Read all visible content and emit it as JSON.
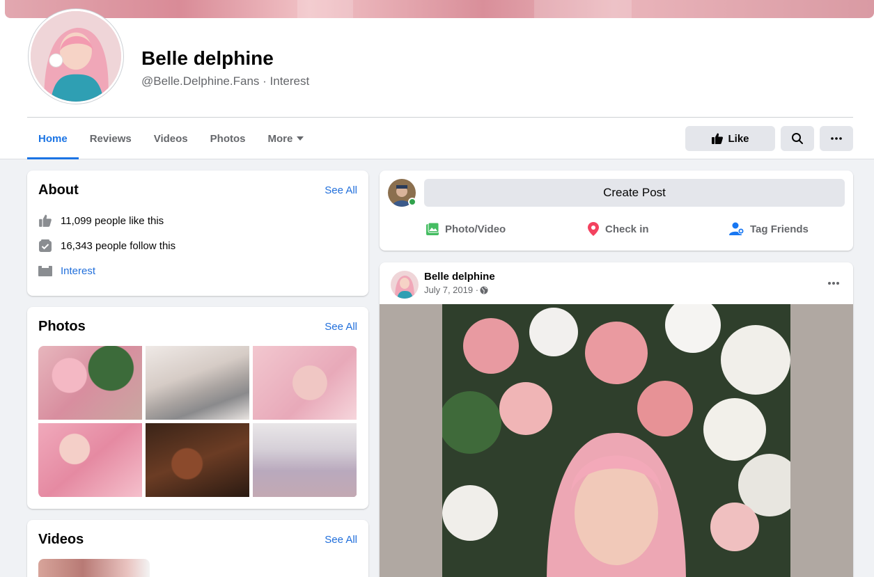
{
  "page": {
    "name": "Belle delphine",
    "handle_line": "@Belle.Delphine.Fans · Interest"
  },
  "tabs": [
    {
      "label": "Home",
      "active": true
    },
    {
      "label": "Reviews"
    },
    {
      "label": "Videos"
    },
    {
      "label": "Photos"
    },
    {
      "label": "More"
    }
  ],
  "actions": {
    "like_label": "Like",
    "search_icon": "search-icon",
    "more_icon": "ellipsis-icon"
  },
  "about": {
    "title": "About",
    "see_all": "See All",
    "likes": "11,099 people like this",
    "follows": "16,343 people follow this",
    "category": "Interest"
  },
  "photos": {
    "title": "Photos",
    "see_all": "See All"
  },
  "videos": {
    "title": "Videos",
    "see_all": "See All"
  },
  "composer": {
    "create_post": "Create Post",
    "photo_video": "Photo/Video",
    "check_in": "Check in",
    "tag_friends": "Tag Friends"
  },
  "post": {
    "author": "Belle delphine",
    "date": "July 7, 2019 · "
  },
  "colors": {
    "accent": "#1b74e4",
    "link": "#216fdb",
    "photo_icon": "#45bd62",
    "checkin_icon": "#f3425f",
    "tag_icon": "#1877f2",
    "online": "#31a24c"
  }
}
